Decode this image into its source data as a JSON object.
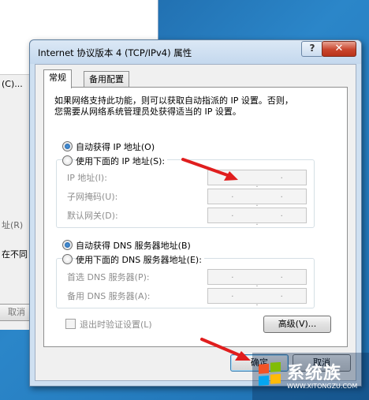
{
  "background_window": {
    "lines": [
      "(C)...",
      "址(R)",
      "在不同",
      "取消"
    ]
  },
  "dialog": {
    "title": "Internet 协议版本 4 (TCP/IPv4) 属性",
    "help_label": "?",
    "close_label": "✕",
    "tabs": [
      "常规",
      "备用配置"
    ],
    "description_line1": "如果网络支持此功能，则可以获取自动指派的 IP 设置。否则，",
    "description_line2": "您需要从网络系统管理员处获得适当的 IP 设置。",
    "ip": {
      "auto_label": "自动获得 IP 地址(O)",
      "manual_label": "使用下面的 IP 地址(S):",
      "selected": "auto",
      "fields": [
        {
          "label": "IP 地址(I):",
          "value": ". . ."
        },
        {
          "label": "子网掩码(U):",
          "value": ". . ."
        },
        {
          "label": "默认网关(D):",
          "value": ". . ."
        }
      ]
    },
    "dns": {
      "auto_label": "自动获得 DNS 服务器地址(B)",
      "manual_label": "使用下面的 DNS 服务器地址(E):",
      "selected": "auto",
      "fields": [
        {
          "label": "首选 DNS 服务器(P):",
          "value": ". . ."
        },
        {
          "label": "备用 DNS 服务器(A):",
          "value": ". . ."
        }
      ]
    },
    "validate_on_exit_label": "退出时验证设置(L)",
    "advanced_label": "高级(V)...",
    "ok_label": "确定",
    "cancel_label": "取消"
  },
  "watermark": {
    "name": "系统族",
    "url": "WWW.XITONGZU.COM"
  },
  "colors": {
    "arrow": "#e01e1e",
    "dialog_frame": "#cfe0f1",
    "desktop": "#2b86c9"
  }
}
